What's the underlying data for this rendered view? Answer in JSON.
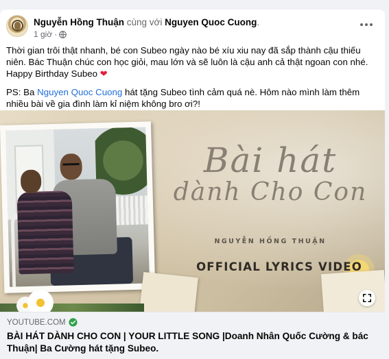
{
  "post": {
    "author": "Nguyễn Hồng Thuận",
    "with_text": "cùng với",
    "tagged": "Nguyen Quoc Cuong",
    "period": ".",
    "time": "1 giờ",
    "separator": "·",
    "privacy_icon": "globe-icon",
    "more_icon": "more-horizontal-icon"
  },
  "body": {
    "paragraph1": "Thời gian trôi thật nhanh, bé con Subeo ngày nào bé xíu xiu nay đã sắp thành cậu thiếu niên. Bác Thuận chúc con học giỏi, mau lớn và sẽ luôn là cậu anh cả thật ngoan con nhé.",
    "line_birthday": "Happy Birthday Subeo",
    "heart": "❤",
    "ps_prefix": "PS: Ba ",
    "ps_mention": "Nguyen Quoc Cuong",
    "ps_rest": " hát tặng Subeo tình cảm quá nè. Hôm nào mình làm thêm nhiều bài về gia đình làm kỉ niệm không bro ơi?!"
  },
  "media": {
    "script_line1": "Bài hát",
    "script_line2": "dành Cho Con",
    "artist": "NGUYỄN HỒNG THUẬN",
    "label": "OFFICIAL LYRICS VIDEO",
    "expand_icon": "expand-icon"
  },
  "link": {
    "domain": "YOUTUBE.COM",
    "verified_icon": "verified-check-icon",
    "title": "BÀI HÁT DÀNH CHO CON | YOUR LITTLE SONG |Doanh Nhân Quốc Cường & bác Thuận| Ba Cường hát tặng Subeo."
  },
  "colors": {
    "link_blue": "#216fdb",
    "secondary_text": "#65676b",
    "heart_red": "#e41e3f",
    "verified_green": "#31a24c"
  }
}
